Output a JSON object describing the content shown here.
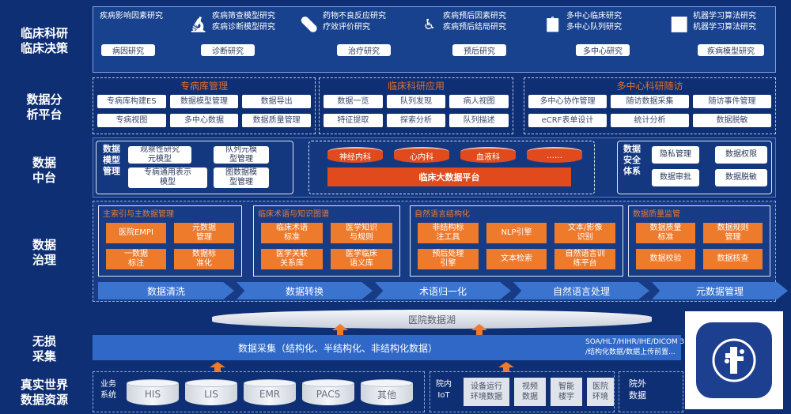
{
  "side_labels": {
    "decision": "临床科研\n临床决策",
    "analysis": "数据分\n析平台",
    "middle": "数据\n中台",
    "governance": "数据\n治理",
    "collection": "无损\n采集",
    "sources": "真实世界\n数据资源"
  },
  "decision": {
    "items": [
      {
        "icon": "",
        "line1": "疾病影响因素研究",
        "line2": "",
        "button": "病因研究"
      },
      {
        "icon": "microscope",
        "line1": "疾病筛查模型研究",
        "line2": "疾病诊断模型研究",
        "button": "诊断研究"
      },
      {
        "icon": "pill",
        "line1": "药物不良反应研究",
        "line2": "疗效评价研究",
        "button": "治疗研究"
      },
      {
        "icon": "wheelchair",
        "line1": "疾病预后因素研究",
        "line2": "疾病预后结局研究",
        "button": "预后研究"
      },
      {
        "icon": "report",
        "line1": "多中心临床研究",
        "line2": "多中心队列研究",
        "button": "多中心研究"
      },
      {
        "icon": "chart",
        "line1": "机器学习算法研究",
        "line2": "机器学习算法研究",
        "button": "疾病模型研究"
      }
    ]
  },
  "analysis": {
    "groups": [
      {
        "title": "专病库管理",
        "items": [
          "专病库构建ES",
          "数据模型管理",
          "数据导出",
          "专病视图",
          "多中心数据",
          "数据质量管理"
        ]
      },
      {
        "title": "临床科研应用",
        "items": [
          "数据一览",
          "队列发现",
          "病人视图",
          "特征提取",
          "探索分析",
          "队列描述"
        ]
      },
      {
        "title": "多中心科研随访",
        "items": [
          "多中心协作管理",
          "随访数据采集",
          "随访事件管理",
          "eCRF表单设计",
          "统计分析",
          "数据脱敏"
        ]
      }
    ]
  },
  "middle": {
    "left_title": "数据\n模型\n管理",
    "left_items": [
      "观察性研究\n元模型",
      "队列元模\n型管理",
      "专病通用表示\n模型",
      "图数据模\n型管理"
    ],
    "center_cylinders": [
      "神经内科",
      "心内科",
      "血液科",
      "……"
    ],
    "center_platform": "临床大数据平台",
    "right_title": "数据\n安全\n体系",
    "right_items": [
      "隐私管理",
      "数据权限",
      "数据审批",
      "数据脱敏"
    ]
  },
  "governance": {
    "groups": [
      {
        "title": "主索引与主数据管理",
        "items": [
          "医院EMPI",
          "元数据\n管理",
          "一数据\n标注",
          "数据标\n准化"
        ]
      },
      {
        "title": "临床术语与知识图谱",
        "items": [
          "临床术语\n标准",
          "医学知识\n与规则",
          "医学关联\n关系库",
          "医学临床\n语义库"
        ]
      },
      {
        "title": "自然语言结构化",
        "items": [
          "非结构标\n注工具",
          "NLP引擎",
          "文本/影像\n识别",
          "预后处理\n引擎",
          "文本检索",
          "自然语言训\n练平台"
        ]
      },
      {
        "title": "数据质量监管",
        "items": [
          "数据质量\n标准",
          "数据规则\n管理",
          "数据校验",
          "数据核查"
        ]
      }
    ],
    "pipeline": [
      "数据清洗",
      "数据转换",
      "术语归一化",
      "自然语言处理",
      "元数据管理"
    ]
  },
  "lake": "医院数据湖",
  "collection": {
    "band": "数据采集（结构化、半结构化、非结构化数据）",
    "standard_line1": "SOA/HL7/HIHR/IHE/DICOM 3...",
    "standard_line2": "/结构化数据/数据上传前置..."
  },
  "sources": {
    "business_label": "业务\n系统",
    "business": [
      "HIS",
      "LIS",
      "EMR",
      "PACS",
      "其他"
    ],
    "iot_label": "院内\nIoT",
    "iot": [
      "设备运行\n环境数据",
      "视频\n数据",
      "智能\n楼宇",
      "医院\n环境"
    ],
    "external_label": "院外\n数据"
  },
  "logo_name": "app-logo"
}
